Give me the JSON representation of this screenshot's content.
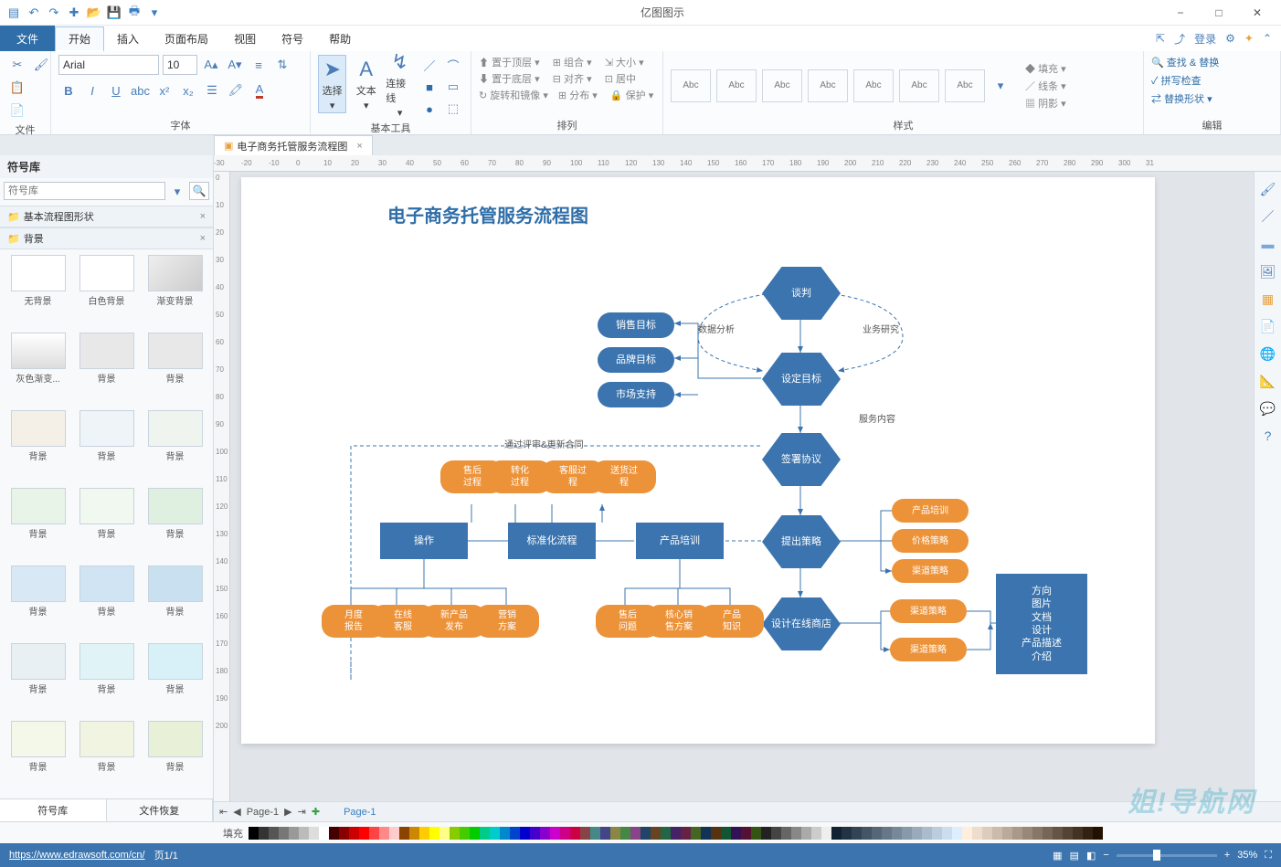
{
  "app_title": "亿图图示",
  "qat_icons": [
    "logo",
    "undo",
    "redo",
    "new",
    "open",
    "save",
    "print",
    "options"
  ],
  "window_controls": {
    "min": "−",
    "max": "□",
    "close": "✕"
  },
  "menu": {
    "file": "文件",
    "tabs": [
      "开始",
      "插入",
      "页面布局",
      "视图",
      "符号",
      "帮助"
    ],
    "active": 0,
    "right": {
      "share": "⇪",
      "link": "⤴",
      "login": "登录",
      "gear": "⚙",
      "cube": "◆",
      "help": "?"
    }
  },
  "ribbon": {
    "file": {
      "label": "文件"
    },
    "font": {
      "label": "字体",
      "name": "Arial",
      "size": "10",
      "btns": [
        "B",
        "I",
        "U",
        "abc",
        "x²",
        "x₂"
      ]
    },
    "tools": {
      "label": "基本工具",
      "select": "选择",
      "text": "文本",
      "connector": "连接线"
    },
    "arrange": {
      "label": "排列",
      "top": "置于顶层",
      "bottom": "置于底层",
      "rotate": "旋转和镜像",
      "group": "组合",
      "align": "对齐",
      "dist": "分布",
      "size": "大小",
      "center": "居中",
      "protect": "保护"
    },
    "style": {
      "label": "样式",
      "presets": [
        "Abc",
        "Abc",
        "Abc",
        "Abc",
        "Abc",
        "Abc",
        "Abc"
      ],
      "fill": "填充",
      "line": "线条",
      "shadow": "阴影"
    },
    "edit": {
      "label": "编辑",
      "find": "查找 & 替换",
      "spell": "拼写检查",
      "replace": "替换形状"
    }
  },
  "doc_tab": "电子商务托管服务流程图",
  "sidepanel": {
    "title": "符号库",
    "cat1": "基本流程图形状",
    "cat2": "背景",
    "thumbs": [
      "无背景",
      "白色背景",
      "渐变背景",
      "灰色渐变...",
      "背景",
      "背景",
      "背景",
      "背景",
      "背景",
      "背景",
      "背景",
      "背景",
      "背景",
      "背景",
      "背景",
      "背景",
      "背景",
      "背景",
      "背景",
      "背景",
      "背景"
    ],
    "tab1": "符号库",
    "tab2": "文件恢复"
  },
  "ruler_h": [
    "-30",
    "-20",
    "-10",
    "0",
    "10",
    "20",
    "30",
    "40",
    "50",
    "60",
    "70",
    "80",
    "90",
    "100",
    "110",
    "120",
    "130",
    "140",
    "150",
    "160",
    "170",
    "180",
    "190",
    "200",
    "210",
    "220",
    "230",
    "240",
    "250",
    "260",
    "270",
    "280",
    "290",
    "300",
    "31"
  ],
  "ruler_v": [
    "0",
    "10",
    "20",
    "30",
    "40",
    "50",
    "60",
    "70",
    "80",
    "90",
    "100",
    "110",
    "120",
    "130",
    "140",
    "150",
    "160",
    "170",
    "180",
    "190",
    "200"
  ],
  "flow": {
    "title": "电子商务托管服务流程图",
    "nodes": {
      "negotiate": "谈判",
      "set_goal": "设定目标",
      "sign": "签署协议",
      "strategy": "提出策略",
      "design": "设计在线商店",
      "sales_goal": "销售目标",
      "brand_goal": "品牌目标",
      "market": "市场支持",
      "review": "通过评审&更新合同",
      "aftersale_p": "售后\n过程",
      "convert_p": "转化\n过程",
      "cs_p": "客服过\n程",
      "ship_p": "送货过\n程",
      "ops": "操作",
      "std": "标准化流程",
      "train": "产品培训",
      "monthly": "月度\n报告",
      "online_cs": "在线\n客服",
      "newprod": "新产品\n发布",
      "mkt_plan": "营销\n方案",
      "as_q": "售后\n问题",
      "core": "核心销\n售方案",
      "prod_k": "产品\n知识",
      "prod_train": "产品培训",
      "price": "价格策略",
      "channel": "渠道策略",
      "channel2": "渠道策略",
      "channel3": "渠道策略",
      "direction": "方向\n图片\n文档\n设计\n产品描述\n介绍",
      "data_analysis": "数据分析",
      "biz_research": "业务研究",
      "service": "服务内容"
    }
  },
  "pagetabs": {
    "page": "Page-1",
    "pagelbl": "Page-1"
  },
  "status": {
    "url": "https://www.edrawsoft.com/cn/",
    "page": "页1/1",
    "fill": "填充",
    "zoom": "35%"
  },
  "watermark": "姐!导航网",
  "rightbar_icons": [
    "format",
    "color",
    "line",
    "shape",
    "image",
    "layer",
    "text",
    "globe",
    "ruler",
    "chat",
    "help"
  ]
}
